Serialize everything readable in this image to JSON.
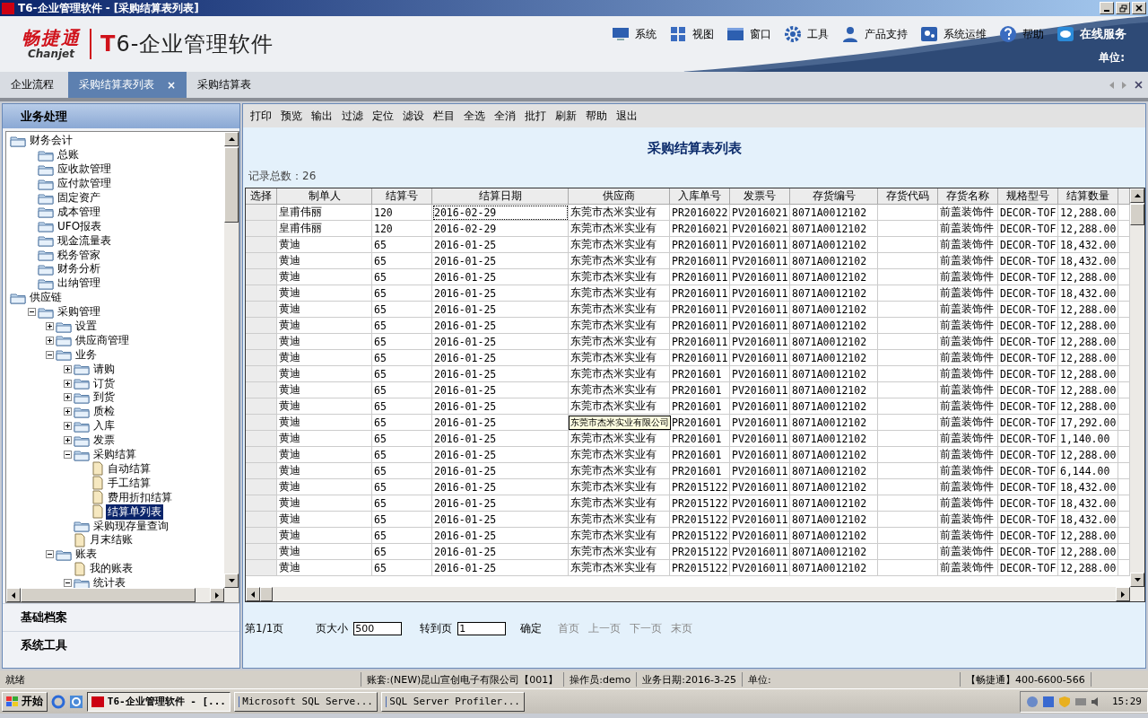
{
  "window": {
    "title": "T6-企业管理软件 - [采购结算表列表]"
  },
  "banner": {
    "brand": "畅捷通",
    "brand_latin": "Chanjet",
    "product": "T6-企业管理软件",
    "menu": [
      {
        "label": "系统",
        "kind": "menu"
      },
      {
        "label": "视图",
        "kind": "menu"
      },
      {
        "label": "窗口",
        "kind": "menu"
      },
      {
        "label": "工具",
        "kind": "menu"
      },
      {
        "label": "产品支持",
        "kind": "menu"
      },
      {
        "label": "系统运维",
        "kind": "menu"
      },
      {
        "label": "帮助",
        "kind": "menu"
      },
      {
        "label": "在线服务",
        "kind": "service"
      }
    ],
    "unit_label": "单位:"
  },
  "tabs": [
    {
      "label": "企业流程",
      "selected": false
    },
    {
      "label": "采购结算表列表",
      "selected": true,
      "close": "×"
    },
    {
      "label": "采购结算表",
      "selected": false
    }
  ],
  "sidebar": {
    "title": "业务处理",
    "tree": [
      {
        "label": "财务会计",
        "kind": "folder",
        "selected": false,
        "children": [
          {
            "label": "总账",
            "kind": "folder",
            "selected": false
          },
          {
            "label": "应收款管理",
            "kind": "folder",
            "selected": false
          },
          {
            "label": "应付款管理",
            "kind": "folder",
            "selected": false
          },
          {
            "label": "固定资产",
            "kind": "folder",
            "selected": false
          },
          {
            "label": "成本管理",
            "kind": "folder",
            "selected": false
          },
          {
            "label": "UFO报表",
            "kind": "folder",
            "selected": false
          },
          {
            "label": "现金流量表",
            "kind": "folder",
            "selected": false
          },
          {
            "label": "税务管家",
            "kind": "folder",
            "selected": false
          },
          {
            "label": "财务分析",
            "kind": "folder",
            "selected": false
          },
          {
            "label": "出纳管理",
            "kind": "folder",
            "selected": false
          }
        ]
      },
      {
        "label": "供应链",
        "kind": "folder",
        "selected": false,
        "children": [
          {
            "label": "采购管理",
            "kind": "folder",
            "selected": false,
            "expanded": true,
            "children": [
              {
                "label": "设置",
                "kind": "folder",
                "selected": false,
                "expanded": false
              },
              {
                "label": "供应商管理",
                "kind": "folder",
                "selected": false,
                "expanded": false
              },
              {
                "label": "业务",
                "kind": "folder",
                "selected": false,
                "expanded": true,
                "children": [
                  {
                    "label": "请购",
                    "kind": "folder",
                    "selected": false,
                    "expanded": false
                  },
                  {
                    "label": "订货",
                    "kind": "folder",
                    "selected": false,
                    "expanded": false
                  },
                  {
                    "label": "到货",
                    "kind": "folder",
                    "selected": false,
                    "expanded": false
                  },
                  {
                    "label": "质检",
                    "kind": "folder",
                    "selected": false,
                    "expanded": false
                  },
                  {
                    "label": "入库",
                    "kind": "folder",
                    "selected": false,
                    "expanded": false
                  },
                  {
                    "label": "发票",
                    "kind": "folder",
                    "selected": false,
                    "expanded": false
                  },
                  {
                    "label": "采购结算",
                    "kind": "folder",
                    "selected": false,
                    "expanded": true,
                    "children": [
                      {
                        "label": "自动结算",
                        "kind": "doc",
                        "selected": false
                      },
                      {
                        "label": "手工结算",
                        "kind": "doc",
                        "selected": false
                      },
                      {
                        "label": "费用折扣结算",
                        "kind": "doc",
                        "selected": false
                      },
                      {
                        "label": "结算单列表",
                        "kind": "doc",
                        "selected": true
                      }
                    ]
                  },
                  {
                    "label": "采购现存量查询",
                    "kind": "folder",
                    "selected": false
                  },
                  {
                    "label": "月末结账",
                    "kind": "doc",
                    "selected": false
                  }
                ]
              },
              {
                "label": "账表",
                "kind": "folder",
                "selected": false,
                "expanded": true,
                "children": [
                  {
                    "label": "我的账表",
                    "kind": "doc",
                    "selected": false
                  },
                  {
                    "label": "统计表",
                    "kind": "folder",
                    "selected": false,
                    "expanded": true
                  }
                ]
              }
            ]
          }
        ]
      }
    ],
    "sections": [
      "基础档案",
      "系统工具"
    ]
  },
  "toolbar": [
    "打印",
    "预览",
    "输出",
    "过滤",
    "定位",
    "滤设",
    "栏目",
    "全选",
    "全消",
    "批打",
    "刷新",
    "帮助",
    "退出"
  ],
  "page_title": "采购结算表列表",
  "record_count": "记录总数：26",
  "table": {
    "columns": [
      "选择",
      "制单人",
      "结算号",
      "结算日期",
      "供应商",
      "入库单号",
      "发票号",
      "存货编号",
      "存货代码",
      "存货名称",
      "规格型号",
      "结算数量"
    ],
    "rows": [
      {
        "maker": "皇甫伟丽",
        "settle_no": "120",
        "date": "2016-02-29",
        "supplier": "东莞市杰米实业有",
        "receipt_no": "PR2016022",
        "invoice_no": "PV2016021",
        "item_no": "8071A0012102",
        "item_name": "前盖装饰件",
        "spec": "DECOR-TOF",
        "quantity": "12,288.00",
        "focused": true
      },
      {
        "maker": "皇甫伟丽",
        "settle_no": "120",
        "date": "2016-02-29",
        "supplier": "东莞市杰米实业有",
        "receipt_no": "PR2016021",
        "invoice_no": "PV2016021",
        "item_no": "8071A0012102",
        "item_name": "前盖装饰件",
        "spec": "DECOR-TOF",
        "quantity": "12,288.00",
        "focused": false
      },
      {
        "maker": "黄迪",
        "settle_no": "65",
        "date": "2016-01-25",
        "supplier": "东莞市杰米实业有",
        "receipt_no": "PR2016011",
        "invoice_no": "PV2016011",
        "item_no": "8071A0012102",
        "item_name": "前盖装饰件",
        "spec": "DECOR-TOF",
        "quantity": "18,432.00",
        "focused": false
      },
      {
        "maker": "黄迪",
        "settle_no": "65",
        "date": "2016-01-25",
        "supplier": "东莞市杰米实业有",
        "receipt_no": "PR2016011",
        "invoice_no": "PV2016011",
        "item_no": "8071A0012102",
        "item_name": "前盖装饰件",
        "spec": "DECOR-TOF",
        "quantity": "18,432.00",
        "focused": false
      },
      {
        "maker": "黄迪",
        "settle_no": "65",
        "date": "2016-01-25",
        "supplier": "东莞市杰米实业有",
        "receipt_no": "PR2016011",
        "invoice_no": "PV2016011",
        "item_no": "8071A0012102",
        "item_name": "前盖装饰件",
        "spec": "DECOR-TOF",
        "quantity": "12,288.00",
        "focused": false
      },
      {
        "maker": "黄迪",
        "settle_no": "65",
        "date": "2016-01-25",
        "supplier": "东莞市杰米实业有",
        "receipt_no": "PR2016011",
        "invoice_no": "PV2016011",
        "item_no": "8071A0012102",
        "item_name": "前盖装饰件",
        "spec": "DECOR-TOF",
        "quantity": "18,432.00",
        "focused": false
      },
      {
        "maker": "黄迪",
        "settle_no": "65",
        "date": "2016-01-25",
        "supplier": "东莞市杰米实业有",
        "receipt_no": "PR2016011",
        "invoice_no": "PV2016011",
        "item_no": "8071A0012102",
        "item_name": "前盖装饰件",
        "spec": "DECOR-TOF",
        "quantity": "12,288.00",
        "focused": false
      },
      {
        "maker": "黄迪",
        "settle_no": "65",
        "date": "2016-01-25",
        "supplier": "东莞市杰米实业有",
        "receipt_no": "PR2016011",
        "invoice_no": "PV2016011",
        "item_no": "8071A0012102",
        "item_name": "前盖装饰件",
        "spec": "DECOR-TOF",
        "quantity": "12,288.00",
        "focused": false
      },
      {
        "maker": "黄迪",
        "settle_no": "65",
        "date": "2016-01-25",
        "supplier": "东莞市杰米实业有",
        "receipt_no": "PR2016011",
        "invoice_no": "PV2016011",
        "item_no": "8071A0012102",
        "item_name": "前盖装饰件",
        "spec": "DECOR-TOF",
        "quantity": "12,288.00",
        "focused": false
      },
      {
        "maker": "黄迪",
        "settle_no": "65",
        "date": "2016-01-25",
        "supplier": "东莞市杰米实业有",
        "receipt_no": "PR2016011",
        "invoice_no": "PV2016011",
        "item_no": "8071A0012102",
        "item_name": "前盖装饰件",
        "spec": "DECOR-TOF",
        "quantity": "12,288.00",
        "focused": false
      },
      {
        "maker": "黄迪",
        "settle_no": "65",
        "date": "2016-01-25",
        "supplier": "东莞市杰米实业有",
        "receipt_no": "PR201601",
        "invoice_no": "PV2016011",
        "item_no": "8071A0012102",
        "item_name": "前盖装饰件",
        "spec": "DECOR-TOF",
        "quantity": "12,288.00",
        "focused": false
      },
      {
        "maker": "黄迪",
        "settle_no": "65",
        "date": "2016-01-25",
        "supplier": "东莞市杰米实业有",
        "receipt_no": "PR201601",
        "invoice_no": "PV2016011",
        "item_no": "8071A0012102",
        "item_name": "前盖装饰件",
        "spec": "DECOR-TOF",
        "quantity": "12,288.00",
        "focused": false
      },
      {
        "maker": "黄迪",
        "settle_no": "65",
        "date": "2016-01-25",
        "supplier": "东莞市杰米实业有",
        "receipt_no": "PR201601",
        "invoice_no": "PV2016011",
        "item_no": "8071A0012102",
        "item_name": "前盖装饰件",
        "spec": "DECOR-TOF",
        "quantity": "12,288.00",
        "focused": false
      },
      {
        "maker": "黄迪",
        "settle_no": "65",
        "date": "2016-01-25",
        "supplier_tooltip": "东莞市杰米实业有限公司",
        "receipt_no": "PR201601",
        "invoice_no": "PV2016011",
        "item_no": "8071A0012102",
        "item_name": "前盖装饰件",
        "spec": "DECOR-TOF",
        "quantity": "17,292.00",
        "focused": false
      },
      {
        "maker": "黄迪",
        "settle_no": "65",
        "date": "2016-01-25",
        "supplier": "东莞市杰米实业有",
        "receipt_no": "PR201601",
        "invoice_no": "PV2016011",
        "item_no": "8071A0012102",
        "item_name": "前盖装饰件",
        "spec": "DECOR-TOF",
        "quantity": "1,140.00",
        "focused": false
      },
      {
        "maker": "黄迪",
        "settle_no": "65",
        "date": "2016-01-25",
        "supplier": "东莞市杰米实业有",
        "receipt_no": "PR201601",
        "invoice_no": "PV2016011",
        "item_no": "8071A0012102",
        "item_name": "前盖装饰件",
        "spec": "DECOR-TOF",
        "quantity": "12,288.00",
        "focused": false
      },
      {
        "maker": "黄迪",
        "settle_no": "65",
        "date": "2016-01-25",
        "supplier": "东莞市杰米实业有",
        "receipt_no": "PR201601",
        "invoice_no": "PV2016011",
        "item_no": "8071A0012102",
        "item_name": "前盖装饰件",
        "spec": "DECOR-TOF",
        "quantity": "6,144.00",
        "focused": false
      },
      {
        "maker": "黄迪",
        "settle_no": "65",
        "date": "2016-01-25",
        "supplier": "东莞市杰米实业有",
        "receipt_no": "PR2015122",
        "invoice_no": "PV2016011",
        "item_no": "8071A0012102",
        "item_name": "前盖装饰件",
        "spec": "DECOR-TOF",
        "quantity": "18,432.00",
        "focused": false
      },
      {
        "maker": "黄迪",
        "settle_no": "65",
        "date": "2016-01-25",
        "supplier": "东莞市杰米实业有",
        "receipt_no": "PR2015122",
        "invoice_no": "PV2016011",
        "item_no": "8071A0012102",
        "item_name": "前盖装饰件",
        "spec": "DECOR-TOF",
        "quantity": "18,432.00",
        "focused": false
      },
      {
        "maker": "黄迪",
        "settle_no": "65",
        "date": "2016-01-25",
        "supplier": "东莞市杰米实业有",
        "receipt_no": "PR2015122",
        "invoice_no": "PV2016011",
        "item_no": "8071A0012102",
        "item_name": "前盖装饰件",
        "spec": "DECOR-TOF",
        "quantity": "18,432.00",
        "focused": false
      },
      {
        "maker": "黄迪",
        "settle_no": "65",
        "date": "2016-01-25",
        "supplier": "东莞市杰米实业有",
        "receipt_no": "PR2015122",
        "invoice_no": "PV2016011",
        "item_no": "8071A0012102",
        "item_name": "前盖装饰件",
        "spec": "DECOR-TOF",
        "quantity": "12,288.00",
        "focused": false
      },
      {
        "maker": "黄迪",
        "settle_no": "65",
        "date": "2016-01-25",
        "supplier": "东莞市杰米实业有",
        "receipt_no": "PR2015122",
        "invoice_no": "PV2016011",
        "item_no": "8071A0012102",
        "item_name": "前盖装饰件",
        "spec": "DECOR-TOF",
        "quantity": "12,288.00",
        "focused": false
      },
      {
        "maker": "黄迪",
        "settle_no": "65",
        "date": "2016-01-25",
        "supplier": "东莞市杰米实业有",
        "receipt_no": "PR2015122",
        "invoice_no": "PV2016011",
        "item_no": "8071A0012102",
        "item_name": "前盖装饰件",
        "spec": "DECOR-TOF",
        "quantity": "12,288.00",
        "focused": false
      }
    ]
  },
  "pagination": {
    "page": "第1/1页",
    "size_label": "页大小",
    "size_value": "500",
    "goto_label": "转到页",
    "goto_value": "1",
    "confirm": "确定",
    "links": [
      {
        "label": "首页",
        "disabled": true
      },
      {
        "label": "上一页",
        "disabled": true
      },
      {
        "label": "下一页",
        "disabled": true
      },
      {
        "label": "末页",
        "disabled": true
      }
    ]
  },
  "status_bar": [
    "就绪",
    "账套:(NEW)昆山宣创电子有限公司【001】",
    "操作员:demo",
    "业务日期:2016-3-25",
    "单位:",
    "【畅捷通】400-6600-566"
  ],
  "taskbar": {
    "start": "开始",
    "tasks": [
      {
        "label": "T6-企业管理软件 - [...",
        "selected": true
      },
      {
        "label": "Microsoft SQL Serve...",
        "selected": false
      },
      {
        "label": "SQL Server Profiler...",
        "selected": false
      }
    ],
    "clock": "15:29"
  }
}
